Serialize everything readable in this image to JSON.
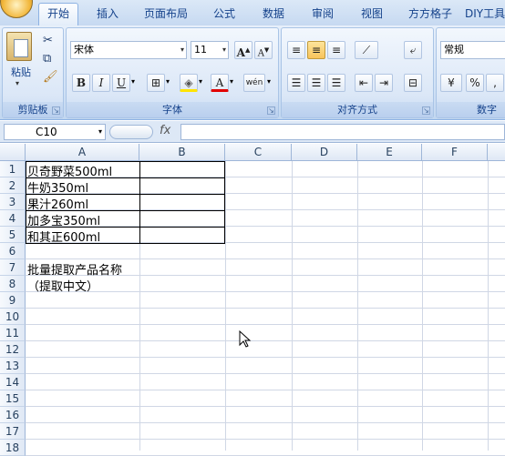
{
  "tabs": [
    "开始",
    "插入",
    "页面布局",
    "公式",
    "数据",
    "审阅",
    "视图",
    "方方格子",
    "DIY工具箱"
  ],
  "active_tab": "开始",
  "clipboard": {
    "paste_label": "粘贴",
    "group_label": "剪贴板"
  },
  "font": {
    "name": "宋体",
    "size": "11",
    "group_label": "字体",
    "bold": "B",
    "italic": "I",
    "underline": "U",
    "grow": "A",
    "shrink": "A",
    "color_letter": "A",
    "phonetic": "wén"
  },
  "alignment": {
    "group_label": "对齐方式"
  },
  "number": {
    "format": "常规",
    "group_label": "数字",
    "percent": "%",
    "comma": ","
  },
  "formula_bar": {
    "name_box": "C10",
    "fx": "fx",
    "value": ""
  },
  "columns": [
    "A",
    "B",
    "C",
    "D",
    "E",
    "F"
  ],
  "rows": [
    "1",
    "2",
    "3",
    "4",
    "5",
    "6",
    "7",
    "8",
    "9",
    "10",
    "11",
    "12",
    "13",
    "14",
    "15",
    "16",
    "17",
    "18"
  ],
  "cells": [
    {
      "row": 1,
      "text": "贝奇野菜500ml"
    },
    {
      "row": 2,
      "text": "牛奶350ml"
    },
    {
      "row": 3,
      "text": "果汁260ml"
    },
    {
      "row": 4,
      "text": "加多宝350ml"
    },
    {
      "row": 5,
      "text": "和其正600ml"
    },
    {
      "row": 7,
      "text": "批量提取产品名称"
    },
    {
      "row": 8,
      "text": "（提取中文）"
    }
  ],
  "colors": {
    "accent": "#15428b",
    "ribbon": "#cfe0f5",
    "grid_line": "#d0d7e5",
    "header": "#dfe8f5"
  }
}
